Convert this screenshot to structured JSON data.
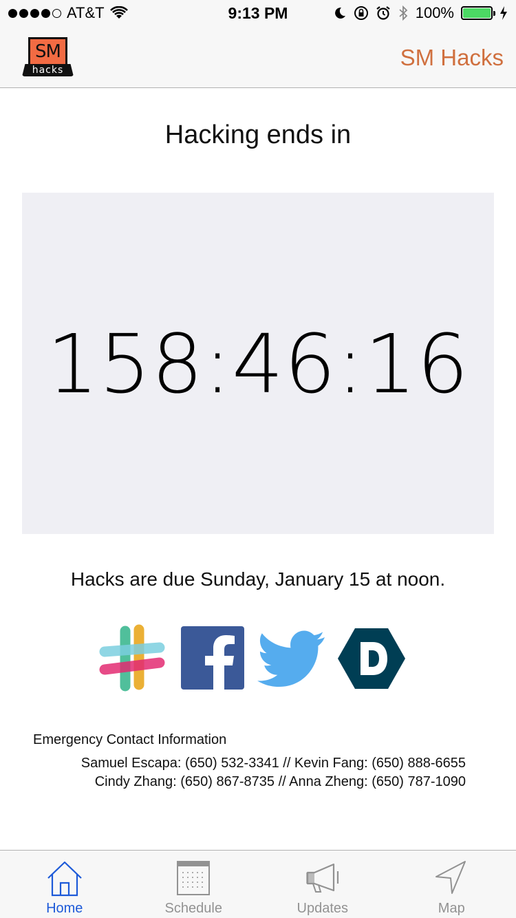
{
  "status_bar": {
    "carrier": "AT&T",
    "time": "9:13 PM",
    "battery": "100%",
    "signal_bars_filled": 4,
    "signal_bars_total": 5,
    "battery_level": 1.0,
    "icons": [
      "wifi-icon",
      "moon-icon",
      "rotation-lock-icon",
      "alarm-icon",
      "bluetooth-icon",
      "charging-icon"
    ]
  },
  "nav": {
    "logo_top": "SM",
    "logo_bottom": "hacks",
    "title": "SM Hacks",
    "accent_color": "#d0703f"
  },
  "main": {
    "heading": "Hacking ends in",
    "countdown": "158:46:16",
    "due_text": "Hacks are due Sunday, January 15 at noon.",
    "social_links": [
      {
        "name": "slack-icon"
      },
      {
        "name": "facebook-icon"
      },
      {
        "name": "twitter-icon"
      },
      {
        "name": "devpost-icon"
      }
    ]
  },
  "contact": {
    "title": "Emergency Contact Information",
    "lines": [
      "Samuel Escapa: (650) 532-3341 // Kevin Fang: (650) 888-6655",
      "Cindy Zhang: (650) 867-8735 // Anna Zheng: (650) 787-1090"
    ]
  },
  "tabs": [
    {
      "label": "Home",
      "icon": "home-icon",
      "active": true
    },
    {
      "label": "Schedule",
      "icon": "calendar-icon",
      "active": false
    },
    {
      "label": "Updates",
      "icon": "megaphone-icon",
      "active": false
    },
    {
      "label": "Map",
      "icon": "navigation-arrow-icon",
      "active": false
    }
  ],
  "colors": {
    "tab_active": "#1d5ad8",
    "tab_inactive": "#929292",
    "timer_background": "#efeff4"
  }
}
